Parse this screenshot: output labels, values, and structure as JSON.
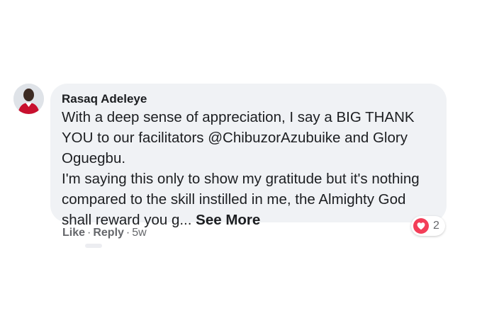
{
  "comment": {
    "author": "Rasaq Adeleye",
    "lines": [
      "With a deep sense of appreciation, I say a BIG THANK",
      "YOU to our facilitators @ChibuzorAzubuike and Glory",
      "Oguegbu.",
      "I'm saying this only to show my gratitude but it's nothing",
      "compared to the skill instilled in me, the Almighty God",
      "shall reward you g... "
    ],
    "see_more": "See More",
    "reaction_count": "2",
    "reaction_icon": "love-icon"
  },
  "actions": {
    "like": "Like",
    "separator": "·",
    "reply": "Reply",
    "time": "5w"
  },
  "colors": {
    "bubble": "#f0f2f5",
    "text": "#1c1e21",
    "meta": "#65676b",
    "love": "#f33e58"
  }
}
